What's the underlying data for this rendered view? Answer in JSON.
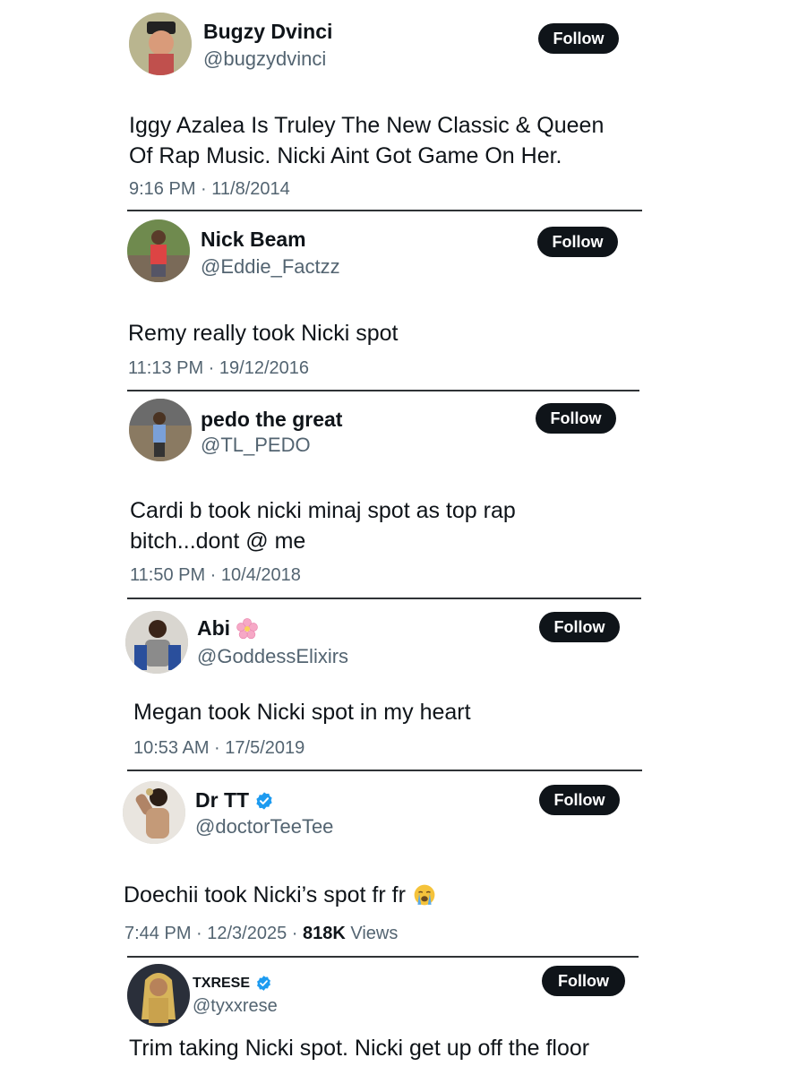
{
  "colors": {
    "text": "#0f1419",
    "muted": "#536471",
    "verified": "#1d9bf0",
    "button": "#0f1419"
  },
  "follow_label": "Follow",
  "tweets": [
    {
      "name": "Bugzy Dvinci",
      "handle": "@bugzydvinci",
      "lines": [
        "Iggy Azalea Is Truley The New Classic & Queen",
        "Of Rap Music. Nicki Aint Got Game On Her."
      ],
      "time": "9:16 PM · 11/8/2014"
    },
    {
      "name": "Nick Beam",
      "handle": "@Eddie_Factzz",
      "lines": [
        "Remy really took Nicki spot"
      ],
      "time": "11:13 PM · 19/12/2016"
    },
    {
      "name": "pedo the great",
      "handle": "@TL_PEDO",
      "lines": [
        "Cardi b took nicki minaj spot as top rap",
        "bitch...dont @ me"
      ],
      "time": "11:50 PM · 10/4/2018"
    },
    {
      "name": "Abi",
      "name_icon": "cherry-blossom-emoji",
      "handle": "@GoddessElixirs",
      "lines": [
        "Megan took Nicki spot in my heart"
      ],
      "time": "10:53 AM · 17/5/2019"
    },
    {
      "name": "Dr TT",
      "name_icon": "verified-badge-icon",
      "handle": "@doctorTeeTee",
      "lines": [
        "Doechii took Nicki’s spot fr fr"
      ],
      "line_icon": "loudly-crying-face-emoji",
      "time": "7:44 PM · 12/3/2025 · ",
      "views_count": "818K",
      "views_label": " Views"
    },
    {
      "name": "TXRESE",
      "name_icon": "verified-badge-icon",
      "handle": "@tyxxrese",
      "lines": [
        "Trim taking Nicki spot. Nicki get up off the floor"
      ]
    }
  ]
}
